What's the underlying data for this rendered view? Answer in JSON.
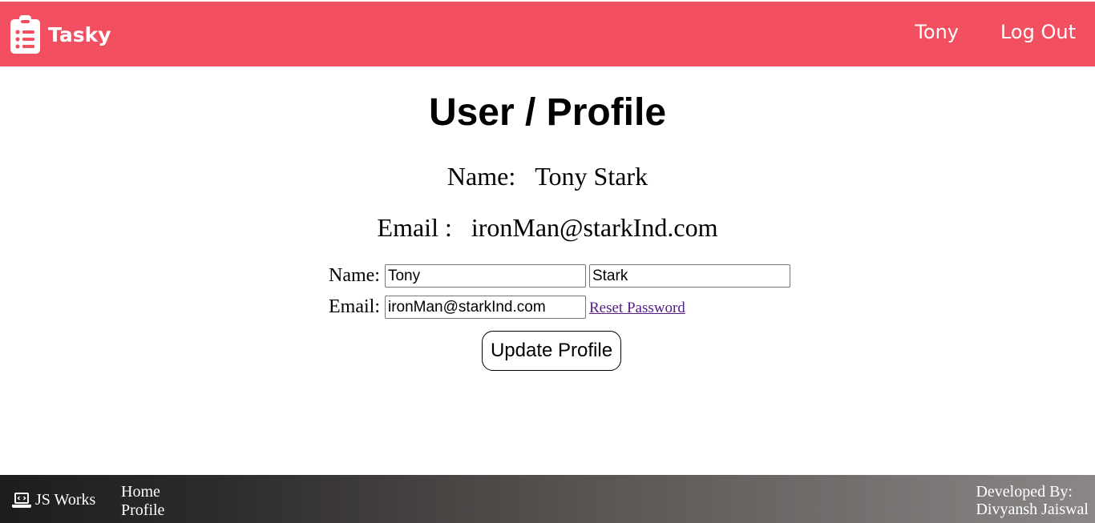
{
  "navbar": {
    "brand_name": "Tasky",
    "brand_icon": "clipboard-list-icon",
    "links": [
      {
        "label": "Tony"
      },
      {
        "label": "Log Out"
      }
    ],
    "bg_color": "#f24f60"
  },
  "main": {
    "title": "User / Profile",
    "name_label": "Name:",
    "name_value": "Tony Stark",
    "email_label": "Email :",
    "email_value": "ironMan@starkInd.com"
  },
  "form": {
    "name_label": "Name:",
    "first_name_value": "Tony",
    "last_name_value": "Stark",
    "email_label": "Email:",
    "email_value": "ironMan@starkInd.com",
    "reset_password_label": "Reset Password",
    "update_button_label": "Update Profile"
  },
  "footer": {
    "brand_name": "JS Works",
    "brand_icon": "laptop-code-icon",
    "links": [
      {
        "label": "Home"
      },
      {
        "label": "Profile"
      }
    ],
    "credit_line1": "Developed By:",
    "credit_line2": "Divyansh Jaiswal"
  }
}
